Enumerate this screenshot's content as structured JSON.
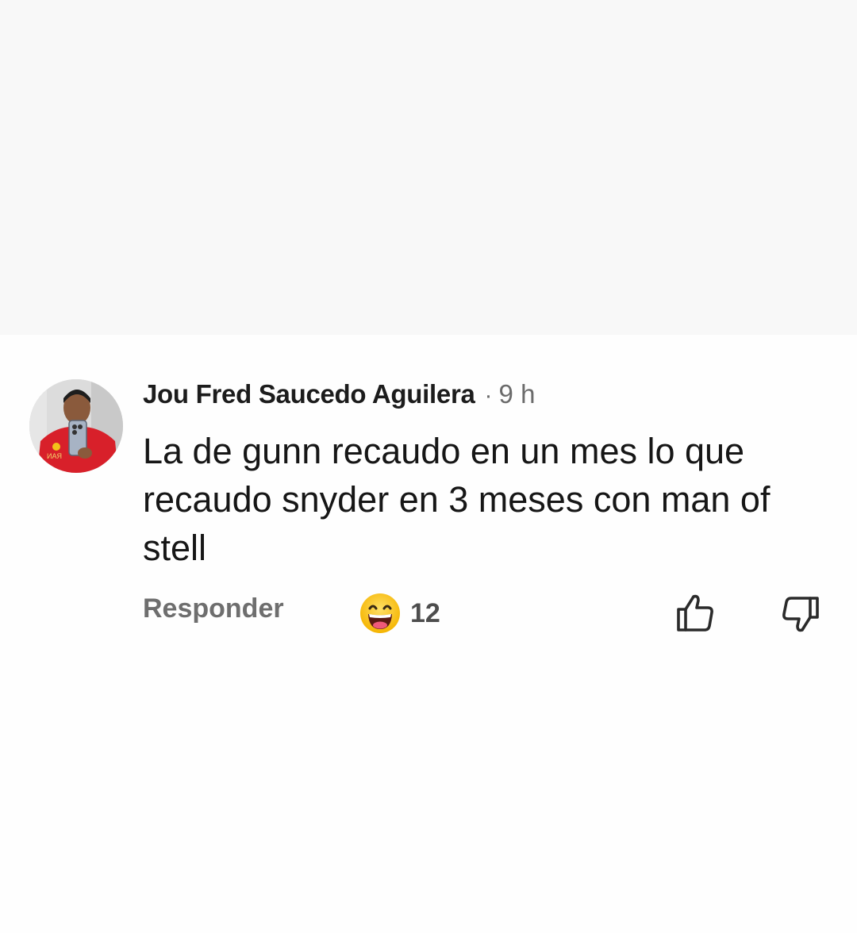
{
  "comment": {
    "author": "Jou Fred Saucedo Aguilera",
    "separator": "·",
    "time": "9 h",
    "text": "La de gunn recaudo en un mes lo que recaudo snyder en 3 meses con man of stell",
    "reply_label": "Responder",
    "reaction": {
      "icon": "grinning-face-icon",
      "count": "12"
    },
    "like_icon": "thumbs-up-icon",
    "dislike_icon": "thumbs-down-icon"
  },
  "colors": {
    "background": "#fdfdfd",
    "text": "#161616",
    "muted": "#6e6e6e"
  }
}
